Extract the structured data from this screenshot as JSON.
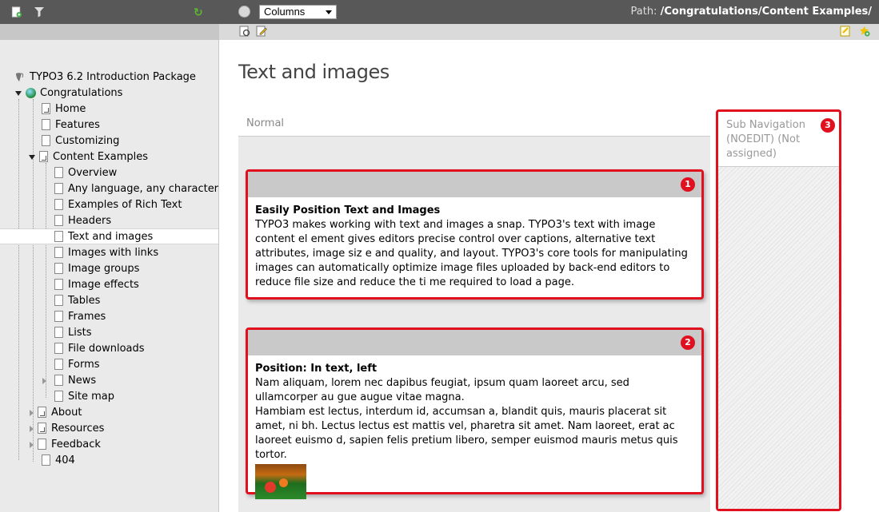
{
  "topbar": {
    "view_select": "Columns",
    "path_label": "Path:",
    "path_value": "/Congratulations/Content Examples/"
  },
  "tree": {
    "root": "TYPO3 6.2 Introduction Package",
    "site": "Congratulations",
    "items": [
      "Home",
      "Features",
      "Customizing",
      "Content Examples",
      "Overview",
      "Any language, any character",
      "Examples of Rich Text",
      "Headers",
      "Text and images",
      "Images with links",
      "Image groups",
      "Image effects",
      "Tables",
      "Frames",
      "Lists",
      "File downloads",
      "Forms",
      "News",
      "Site map",
      "About",
      "Resources",
      "Feedback",
      "404"
    ],
    "selected": "Text and images"
  },
  "main": {
    "title": "Text and images",
    "column_normal": "Normal",
    "subnav_label": "Sub Navigation (NOEDIT) (Not assigned)",
    "elements": [
      {
        "badge": "1",
        "header": "Easily Position Text and Images",
        "body": "TYPO3 makes working with text and images a snap. TYPO3's text with image content el ement gives editors precise control over captions, alternative text attributes, image siz e and quality, and layout. TYPO3's core tools for manipulating images can automatically optimize image files uploaded by back-end editors to reduce file size and reduce the ti me required to load a page."
      },
      {
        "badge": "2",
        "header": "Position: In text, left",
        "body": "Nam aliquam, lorem nec dapibus feugiat, ipsum quam laoreet arcu, sed ullamcorper au gue augue vitae magna.",
        "body2": "Hambiam est lectus, interdum id, accumsan a, blandit quis, mauris placerat sit amet, ni bh. Lectus lectus est mattis vel, pharetra sit amet. Nam laoreet, erat ac laoreet euismo d, sapien felis pretium libero, semper euismod mauris metus quis tortor."
      }
    ],
    "subnav_badge": "3"
  },
  "colors": {
    "highlight": "#e0101f",
    "topbar": "#585858"
  }
}
